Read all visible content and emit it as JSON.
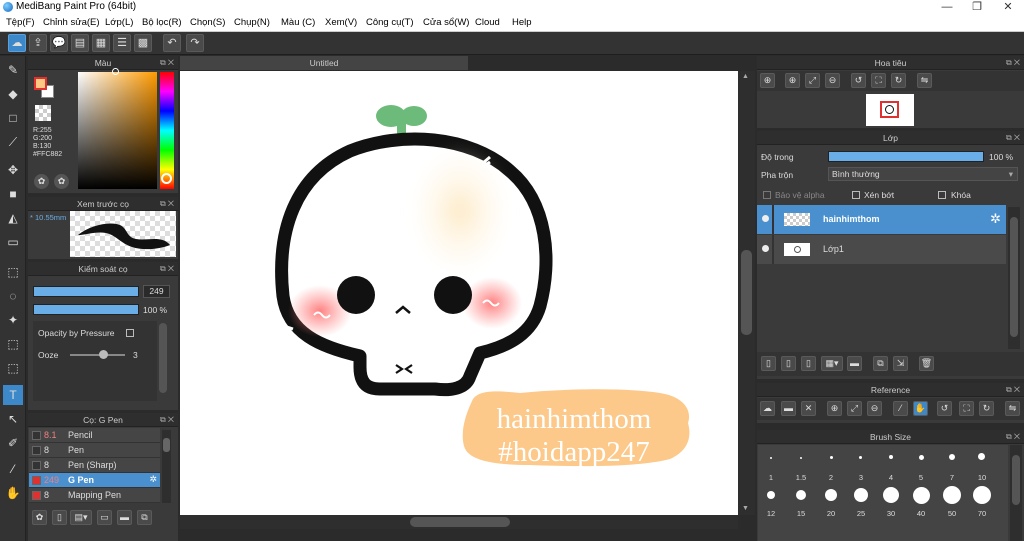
{
  "window": {
    "title": "MediBang Paint Pro (64bit)",
    "min": "—",
    "max": "❐",
    "close": "✕"
  },
  "menu": [
    "Tệp(F)",
    "Chỉnh sửa(E)",
    "Lớp(L)",
    "Bộ lọc(R)",
    "Chọn(S)",
    "Chụp(N)",
    "Màu (C)",
    "Xem(V)",
    "Công cụ(T)",
    "Cửa sổ(W)",
    "Cloud",
    "Help"
  ],
  "canvas_tab": "Untitled",
  "color_panel": {
    "title": "Màu",
    "r": "R:255",
    "g": "G:200",
    "b": "B:130",
    "hex": "#FFC882",
    "fg_color": "#FFC882"
  },
  "brush_preview": {
    "title": "Xem trước cọ",
    "size": "10.55mm"
  },
  "brush_control": {
    "title": "Kiểm soát cọ",
    "size_value": "249",
    "opacity_value": "100 %",
    "opacity_pressure": "Opacity by Pressure",
    "ooze_label": "Ooze",
    "ooze_value": "3"
  },
  "brush_list": {
    "title": "Cọ: G Pen",
    "items": [
      {
        "size": "8.1",
        "name": "Pencil",
        "color": "#333333"
      },
      {
        "size": "8",
        "name": "Pen",
        "color": "#333333"
      },
      {
        "size": "8",
        "name": "Pen (Sharp)",
        "color": "#333333"
      },
      {
        "size": "249",
        "name": "G Pen",
        "color": "#e03030"
      },
      {
        "size": "8",
        "name": "Mapping Pen",
        "color": "#e03030"
      }
    ]
  },
  "navigator": {
    "title": "Hoa tiêu"
  },
  "layers": {
    "title": "Lớp",
    "opacity_label": "Độ trong",
    "opacity_value": "100 %",
    "blend_label": "Pha trộn",
    "blend_value": "Bình thường",
    "protect_alpha": "Bảo vệ alpha",
    "clipping": "Xén bớt",
    "lock": "Khóa",
    "items": [
      {
        "name": "hainhimthom"
      },
      {
        "name": "Lớp1"
      }
    ]
  },
  "reference": {
    "title": "Reference"
  },
  "brush_size": {
    "title": "Brush Size",
    "row1": [
      "1",
      "1.5",
      "2",
      "3",
      "4",
      "5",
      "7",
      "10"
    ],
    "row2": [
      "12",
      "15",
      "20",
      "25",
      "30",
      "40",
      "50",
      "70"
    ]
  },
  "artwork": {
    "line1": "hainhimthom",
    "line2": "#hoidapp247"
  }
}
